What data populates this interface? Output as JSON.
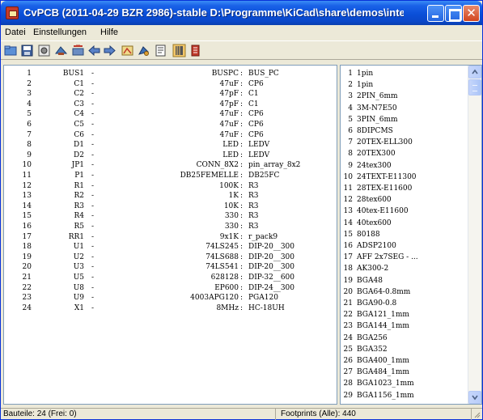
{
  "window": {
    "title": "CvPCB (2011-04-29 BZR 2986)-stable D:\\Programme\\KiCad\\share\\demos\\interf...",
    "buttons": {
      "minimize": "minimize",
      "maximize": "maximize",
      "close": "✕"
    }
  },
  "menu": [
    "Datei",
    "Einstellungen",
    "Hilfe"
  ],
  "toolbar": [
    "open-folder-icon",
    "save-icon",
    "library-config-icon",
    "autoselect-icon",
    "delete-associations-icon",
    "left-arrow-icon",
    "right-arrow-icon",
    "view-module-icon",
    "cursor-icon",
    "document-icon",
    "filter-icon",
    "list-filter-icon"
  ],
  "components": [
    {
      "num": "1",
      "ref": "BUS1",
      "value": "BUSPC",
      "footprint": "BUS_PC"
    },
    {
      "num": "2",
      "ref": "C1",
      "value": "47uF",
      "footprint": "CP6"
    },
    {
      "num": "3",
      "ref": "C2",
      "value": "47pF",
      "footprint": "C1"
    },
    {
      "num": "4",
      "ref": "C3",
      "value": "47pF",
      "footprint": "C1"
    },
    {
      "num": "5",
      "ref": "C4",
      "value": "47uF",
      "footprint": "CP6"
    },
    {
      "num": "6",
      "ref": "C5",
      "value": "47uF",
      "footprint": "CP6"
    },
    {
      "num": "7",
      "ref": "C6",
      "value": "47uF",
      "footprint": "CP6"
    },
    {
      "num": "8",
      "ref": "D1",
      "value": "LED",
      "footprint": "LEDV"
    },
    {
      "num": "9",
      "ref": "D2",
      "value": "LED",
      "footprint": "LEDV"
    },
    {
      "num": "10",
      "ref": "JP1",
      "value": "CONN_8X2",
      "footprint": "pin_array_8x2"
    },
    {
      "num": "11",
      "ref": "P1",
      "value": "DB25FEMELLE",
      "footprint": "DB25FC"
    },
    {
      "num": "12",
      "ref": "R1",
      "value": "100K",
      "footprint": "R3"
    },
    {
      "num": "13",
      "ref": "R2",
      "value": "1K",
      "footprint": "R3"
    },
    {
      "num": "14",
      "ref": "R3",
      "value": "10K",
      "footprint": "R3"
    },
    {
      "num": "15",
      "ref": "R4",
      "value": "330",
      "footprint": "R3"
    },
    {
      "num": "16",
      "ref": "R5",
      "value": "330",
      "footprint": "R3"
    },
    {
      "num": "17",
      "ref": "RR1",
      "value": "9x1K",
      "footprint": "r_pack9"
    },
    {
      "num": "18",
      "ref": "U1",
      "value": "74LS245",
      "footprint": "DIP-20__300"
    },
    {
      "num": "19",
      "ref": "U2",
      "value": "74LS688",
      "footprint": "DIP-20__300"
    },
    {
      "num": "20",
      "ref": "U3",
      "value": "74LS541",
      "footprint": "DIP-20__300"
    },
    {
      "num": "21",
      "ref": "U5",
      "value": "628128",
      "footprint": "DIP-32__600"
    },
    {
      "num": "22",
      "ref": "U8",
      "value": "EP600",
      "footprint": "DIP-24__300"
    },
    {
      "num": "23",
      "ref": "U9",
      "value": "4003APG120",
      "footprint": "PGA120"
    },
    {
      "num": "24",
      "ref": "X1",
      "value": "8MHz",
      "footprint": "HC-18UH"
    }
  ],
  "footprints": [
    {
      "num": "1",
      "name": "1pin"
    },
    {
      "num": "2",
      "name": "1pin"
    },
    {
      "num": "3",
      "name": "2PIN_6mm"
    },
    {
      "num": "4",
      "name": "3M-N7E50"
    },
    {
      "num": "5",
      "name": "3PIN_6mm"
    },
    {
      "num": "6",
      "name": "8DIPCMS"
    },
    {
      "num": "7",
      "name": "20TEX-ELL300"
    },
    {
      "num": "8",
      "name": "20TEX300"
    },
    {
      "num": "9",
      "name": "24tex300"
    },
    {
      "num": "10",
      "name": "24TEXT-E11300"
    },
    {
      "num": "11",
      "name": "28TEX-E11600"
    },
    {
      "num": "12",
      "name": "28tex600"
    },
    {
      "num": "13",
      "name": "40tex-E11600"
    },
    {
      "num": "14",
      "name": "40tex600"
    },
    {
      "num": "15",
      "name": "80188"
    },
    {
      "num": "16",
      "name": "ADSP2100"
    },
    {
      "num": "17",
      "name": "AFF 2x7SEG - ..."
    },
    {
      "num": "18",
      "name": "AK300-2"
    },
    {
      "num": "19",
      "name": "BGA48"
    },
    {
      "num": "20",
      "name": "BGA64-0.8mm"
    },
    {
      "num": "21",
      "name": "BGA90-0.8"
    },
    {
      "num": "22",
      "name": "BGA121_1mm"
    },
    {
      "num": "23",
      "name": "BGA144_1mm"
    },
    {
      "num": "24",
      "name": "BGA256"
    },
    {
      "num": "25",
      "name": "BGA352"
    },
    {
      "num": "26",
      "name": "BGA400_1mm"
    },
    {
      "num": "27",
      "name": "BGA484_1mm"
    },
    {
      "num": "28",
      "name": "BGA1023_1mm"
    },
    {
      "num": "29",
      "name": "BGA1156_1mm"
    }
  ],
  "status": {
    "components": "Bauteile: 24 (Frei: 0)",
    "footprints": "Footprints (Alle): 440"
  },
  "colors": {
    "title_blue": "#0a4fd8",
    "close_red": "#d2461f",
    "panel_border": "#7f9db9"
  }
}
